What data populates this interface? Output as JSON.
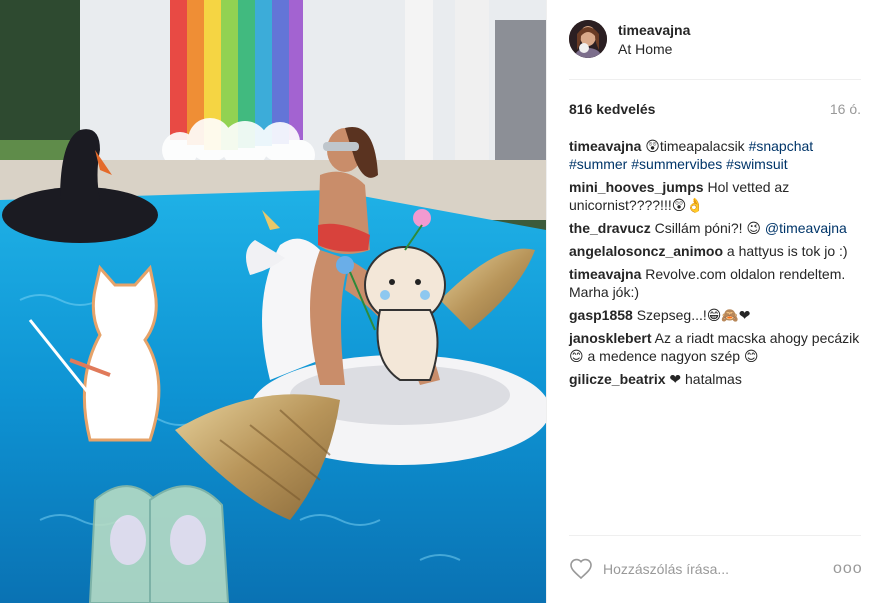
{
  "post": {
    "username": "timeavajna",
    "location": "At Home",
    "likes": "816 kedvelés",
    "time": "16 ó."
  },
  "comments": [
    {
      "user": "timeavajna",
      "segments": [
        {
          "text": " 😲timeapalacsik ",
          "tag": false
        },
        {
          "text": "#snapchat",
          "tag": true
        },
        {
          "text": " ",
          "tag": false
        },
        {
          "text": "#summer",
          "tag": true
        },
        {
          "text": " ",
          "tag": false
        },
        {
          "text": "#summervibes",
          "tag": true
        },
        {
          "text": " ",
          "tag": false
        },
        {
          "text": "#swimsuit",
          "tag": true
        }
      ]
    },
    {
      "user": "mini_hooves_jumps",
      "segments": [
        {
          "text": " Hol vetted az unicornist????!!!😲👌",
          "tag": false
        }
      ]
    },
    {
      "user": "the_dravucz",
      "segments": [
        {
          "text": " Csillám póni?! 😉 ",
          "tag": false
        },
        {
          "text": "@timeavajna",
          "tag": true
        }
      ]
    },
    {
      "user": "angelalosoncz_animoo",
      "segments": [
        {
          "text": " a hattyus is tok jo :)",
          "tag": false
        }
      ]
    },
    {
      "user": "timeavajna",
      "segments": [
        {
          "text": " Revolve.com oldalon rendeltem. Marha jók:)",
          "tag": false
        }
      ]
    },
    {
      "user": "gasp1858",
      "segments": [
        {
          "text": " Szepseg...!😁🙈❤",
          "tag": false
        }
      ]
    },
    {
      "user": "janosklebert",
      "segments": [
        {
          "text": " Az a riadt macska ahogy pecázik 😊 a medence nagyon szép 😊",
          "tag": false
        }
      ]
    },
    {
      "user": "gilicze_beatrix",
      "segments": [
        {
          "text": " ❤ hatalmas",
          "tag": false
        }
      ]
    }
  ],
  "add_comment": {
    "placeholder": "Hozzászólás írása...",
    "more_label": "ooo"
  },
  "icons": {
    "like": "heart-icon",
    "more": "more-options-icon"
  },
  "colors": {
    "link": "#003569",
    "muted": "#999999",
    "text": "#262626",
    "pool": "#0f87c4"
  }
}
